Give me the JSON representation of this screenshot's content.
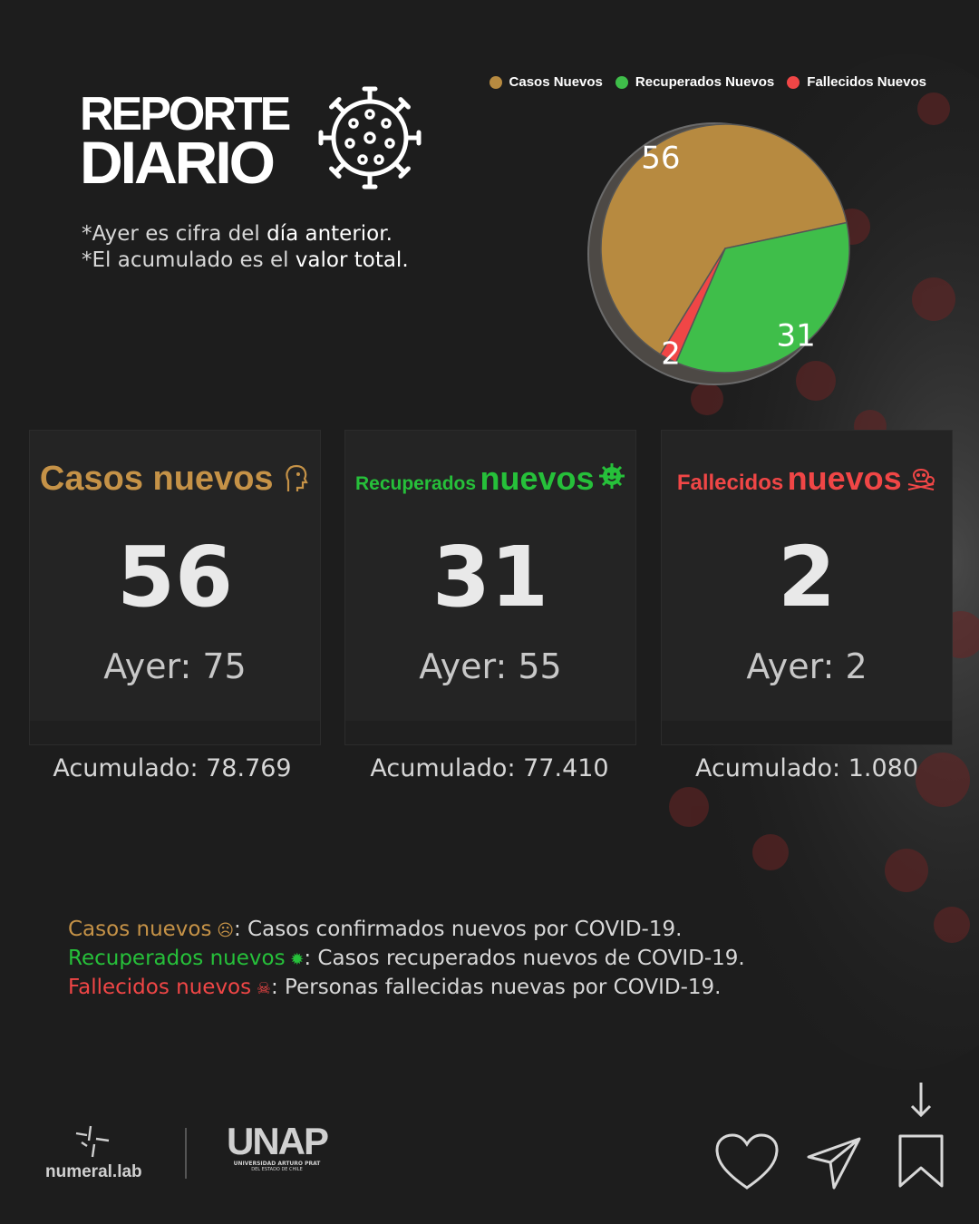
{
  "header": {
    "title_line1": "REPORTE",
    "title_line2": "DIARIO",
    "note1_prefix": "*Ayer es cifra del ",
    "note1_highlight": "día anterior.",
    "note2_prefix": "*El acumulado es el ",
    "note2_highlight": "valor total."
  },
  "legend": [
    {
      "label": "Casos Nuevos",
      "color": "#b78a40"
    },
    {
      "label": "Recuperados Nuevos",
      "color": "#3fbe4a"
    },
    {
      "label": "Fallecidos Nuevos",
      "color": "#f04646"
    }
  ],
  "chart_data": {
    "type": "pie",
    "categories": [
      "Casos Nuevos",
      "Recuperados Nuevos",
      "Fallecidos Nuevos"
    ],
    "values": [
      56,
      31,
      2
    ],
    "colors": [
      "#b78a40",
      "#3fbe4a",
      "#f04646"
    ],
    "data_labels": [
      "56",
      "31",
      "2"
    ],
    "legend_position": "top"
  },
  "cards": [
    {
      "title_a": "Casos nuevos",
      "title_b": "",
      "icon": "sick-face-icon",
      "color": "#c59247",
      "value": "56",
      "ayer": "Ayer: 75",
      "acumulado": "Acumulado: 78.769"
    },
    {
      "title_a": "Recuperados",
      "title_b": "nuevos",
      "icon": "virus-smile-icon",
      "color": "#26c03a",
      "value": "31",
      "ayer": "Ayer: 55",
      "acumulado": "Acumulado: 77.410"
    },
    {
      "title_a": "Fallecidos",
      "title_b": "nuevos",
      "icon": "skull-crossbones-icon",
      "color": "#f04646",
      "value": "2",
      "ayer": "Ayer: 2",
      "acumulado": "Acumulado: 1.080"
    }
  ],
  "definitions": [
    {
      "term": "Casos nuevos",
      "icon": "sick-face-icon",
      "desc": ": Casos confirmados nuevos por COVID-19.",
      "color": "#c59247"
    },
    {
      "term": "Recuperados nuevos",
      "icon": "virus-smile-icon",
      "desc": ": Casos recuperados nuevos de COVID-19.",
      "color": "#26c03a"
    },
    {
      "term": "Fallecidos nuevos",
      "icon": "skull-crossbones-icon",
      "desc": ": Personas fallecidas nuevas por COVID-19.",
      "color": "#f04646"
    }
  ],
  "footer": {
    "brand1": "numeral.lab",
    "brand2": "UNAP",
    "brand2_sub1": "UNIVERSIDAD ARTURO PRAT",
    "brand2_sub2": "DEL ESTADO DE CHILE"
  }
}
